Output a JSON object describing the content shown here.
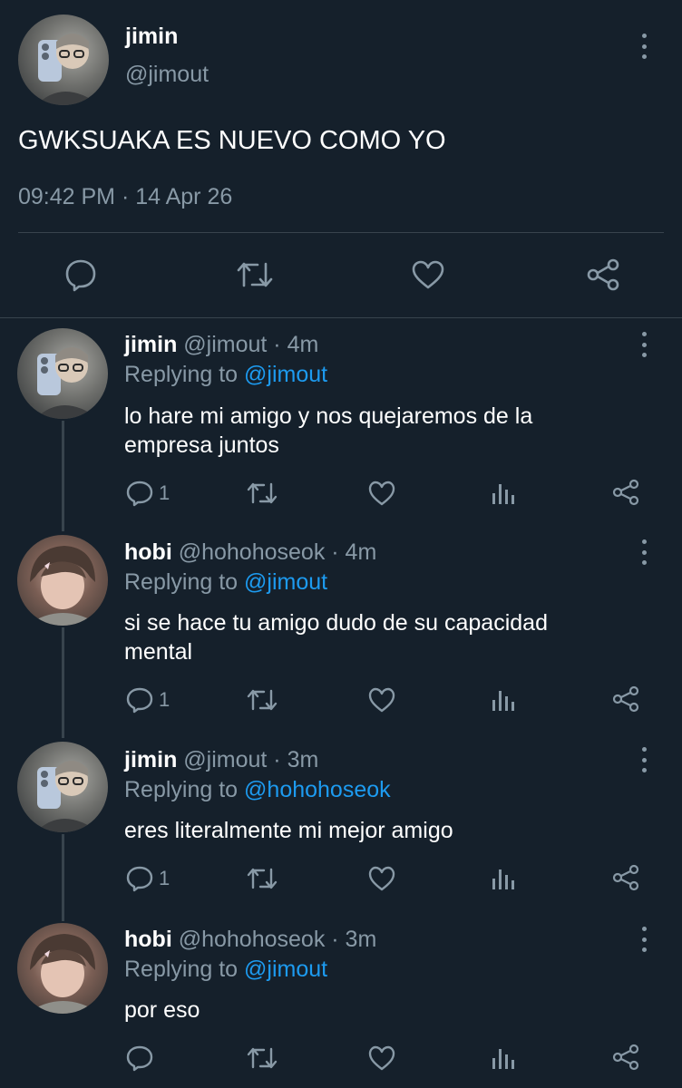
{
  "colors": {
    "background": "#15202b",
    "secondary_text": "#8899a6",
    "link": "#1d9bf0",
    "divider": "#38444d"
  },
  "main_tweet": {
    "display_name": "jimin",
    "handle": "@jimout",
    "text": "GWKSUAKA ES NUEVO COMO YO",
    "timestamp": "09:42 PM · 14 Apr 26",
    "actions": [
      "reply-icon",
      "retweet-icon",
      "like-icon",
      "share-icon"
    ]
  },
  "replies": [
    {
      "display_name": "jimin",
      "meta": "@jimout · 4m",
      "replying_prefix": "Replying to",
      "replying_to": "@jimout",
      "text": "lo hare mi amigo y nos quejaremos de la\nempresa juntos",
      "reply_count": "1"
    },
    {
      "display_name": "hobi",
      "meta": "@hohohoseok · 4m",
      "replying_prefix": "Replying to",
      "replying_to": "@jimout",
      "text": "si se hace tu amigo dudo de su capacidad\nmental",
      "reply_count": "1"
    },
    {
      "display_name": "jimin",
      "meta": "@jimout · 3m",
      "replying_prefix": "Replying to",
      "replying_to": "@hohohoseok",
      "text": "eres literalmente mi mejor amigo",
      "reply_count": "1"
    },
    {
      "display_name": "hobi",
      "meta": "@hohohoseok · 3m",
      "replying_prefix": "Replying to",
      "replying_to": "@jimout",
      "text": "por eso",
      "reply_count": ""
    }
  ]
}
